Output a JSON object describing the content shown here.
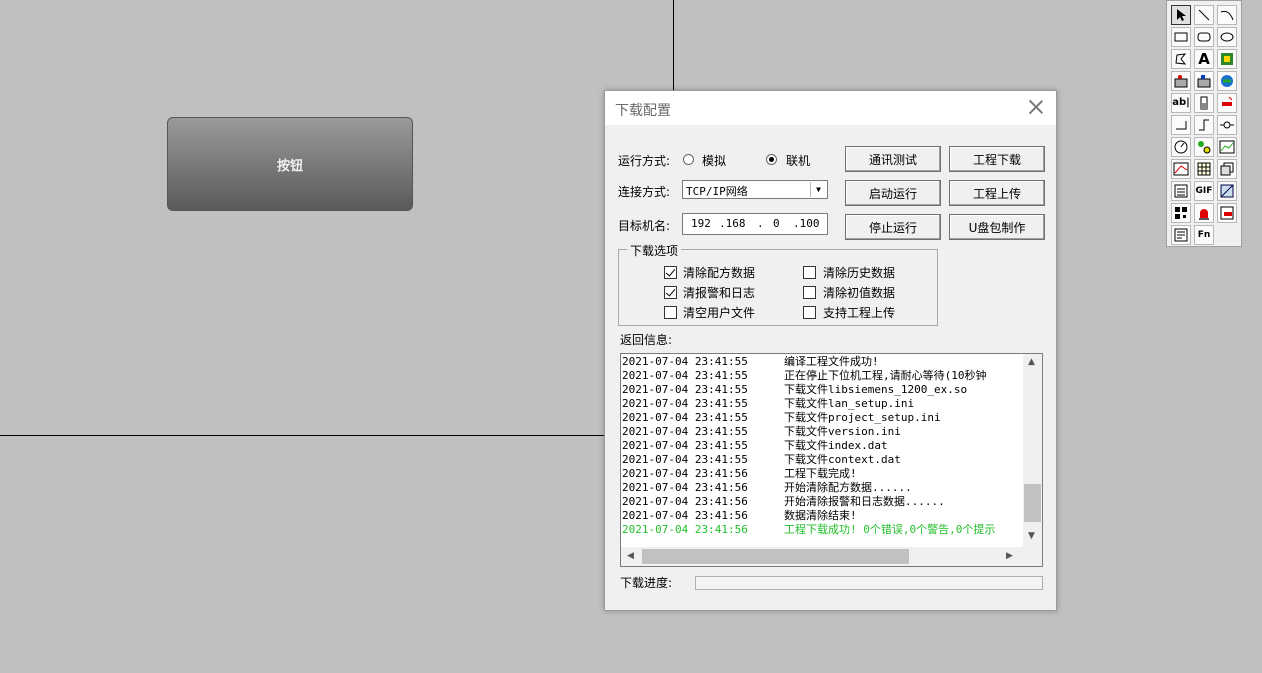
{
  "canvas": {
    "button_label": "按钮"
  },
  "toolbox": {
    "tools": [
      {
        "name": "pointer-tool-icon"
      },
      {
        "name": "line-tool-icon"
      },
      {
        "name": "arc-tool-icon"
      },
      {
        "name": "rectangle-tool-icon"
      },
      {
        "name": "rounded-rectangle-tool-icon"
      },
      {
        "name": "ellipse-tool-icon"
      },
      {
        "name": "polygon-tool-icon"
      },
      {
        "name": "text-tool-icon",
        "glyph": "A"
      },
      {
        "name": "picture-tool-icon"
      },
      {
        "name": "bit-button-tool-icon"
      },
      {
        "name": "word-button-tool-icon"
      },
      {
        "name": "function-key-tool-icon"
      },
      {
        "name": "input-field-tool-icon",
        "glyph": "ab|"
      },
      {
        "name": "bar-graph-tool-icon"
      },
      {
        "name": "indicator-light-tool-icon"
      },
      {
        "name": "pipe-tool-icon"
      },
      {
        "name": "step-line-tool-icon"
      },
      {
        "name": "valve-tool-icon"
      },
      {
        "name": "gauge-tool-icon"
      },
      {
        "name": "animation-tool-icon"
      },
      {
        "name": "trend-chart-tool-icon"
      },
      {
        "name": "xy-chart-tool-icon"
      },
      {
        "name": "table-tool-icon"
      },
      {
        "name": "recipe-tool-icon"
      },
      {
        "name": "alarm-display-tool-icon"
      },
      {
        "name": "gif-tool-icon",
        "glyph": "GIF"
      },
      {
        "name": "graphic-view-tool-icon"
      },
      {
        "name": "qr-code-tool-icon"
      },
      {
        "name": "alarm-lamp-tool-icon"
      },
      {
        "name": "history-viewer-tool-icon"
      },
      {
        "name": "report-tool-icon"
      },
      {
        "name": "function-tool-icon",
        "glyph": "Fn"
      }
    ]
  },
  "dialog": {
    "title": "下载配置",
    "run_mode_label": "运行方式:",
    "run_mode_options": [
      "模拟",
      "联机"
    ],
    "run_mode_selected": "联机",
    "connection_label": "连接方式:",
    "connection_value": "TCP/IP网络",
    "target_label": "目标机名:",
    "ip": [
      "192",
      ".168",
      ".",
      "0",
      ".100"
    ],
    "buttons": {
      "comm_test": "通讯测试",
      "project_download": "工程下载",
      "start_run": "启动运行",
      "project_upload": "工程上传",
      "stop_run": "停止运行",
      "usb_package": "U盘包制作"
    },
    "download_options": {
      "title": "下载选项",
      "items": [
        {
          "label": "清除配方数据",
          "checked": true
        },
        {
          "label": "清除历史数据",
          "checked": false
        },
        {
          "label": "清报警和日志",
          "checked": true
        },
        {
          "label": "清除初值数据",
          "checked": false
        },
        {
          "label": "清空用户文件",
          "checked": false
        },
        {
          "label": "支持工程上传",
          "checked": false
        }
      ]
    },
    "log_label": "返回信息:",
    "log_lines": [
      {
        "ts": "2021-07-04 23:41:55",
        "msg": "编译工程文件成功!"
      },
      {
        "ts": "2021-07-04 23:41:55",
        "msg": "正在停止下位机工程,请耐心等待(10秒钟"
      },
      {
        "ts": "2021-07-04 23:41:55",
        "msg": "下载文件libsiemens_1200_ex.so"
      },
      {
        "ts": "2021-07-04 23:41:55",
        "msg": "下载文件lan_setup.ini"
      },
      {
        "ts": "2021-07-04 23:41:55",
        "msg": "下载文件project_setup.ini"
      },
      {
        "ts": "2021-07-04 23:41:55",
        "msg": "下载文件version.ini"
      },
      {
        "ts": "2021-07-04 23:41:55",
        "msg": "下载文件index.dat"
      },
      {
        "ts": "2021-07-04 23:41:55",
        "msg": "下载文件context.dat"
      },
      {
        "ts": "2021-07-04 23:41:56",
        "msg": "工程下载完成!"
      },
      {
        "ts": "2021-07-04 23:41:56",
        "msg": "开始清除配方数据......"
      },
      {
        "ts": "2021-07-04 23:41:56",
        "msg": "开始清除报警和日志数据......"
      },
      {
        "ts": "2021-07-04 23:41:56",
        "msg": "数据清除结束!"
      },
      {
        "ts": "2021-07-04 23:41:56",
        "msg": "工程下载成功! 0个错误,0个警告,0个提示",
        "success": true
      }
    ],
    "progress_label": "下载进度:",
    "progress_value": 0,
    "success_color": "#22c02a"
  }
}
